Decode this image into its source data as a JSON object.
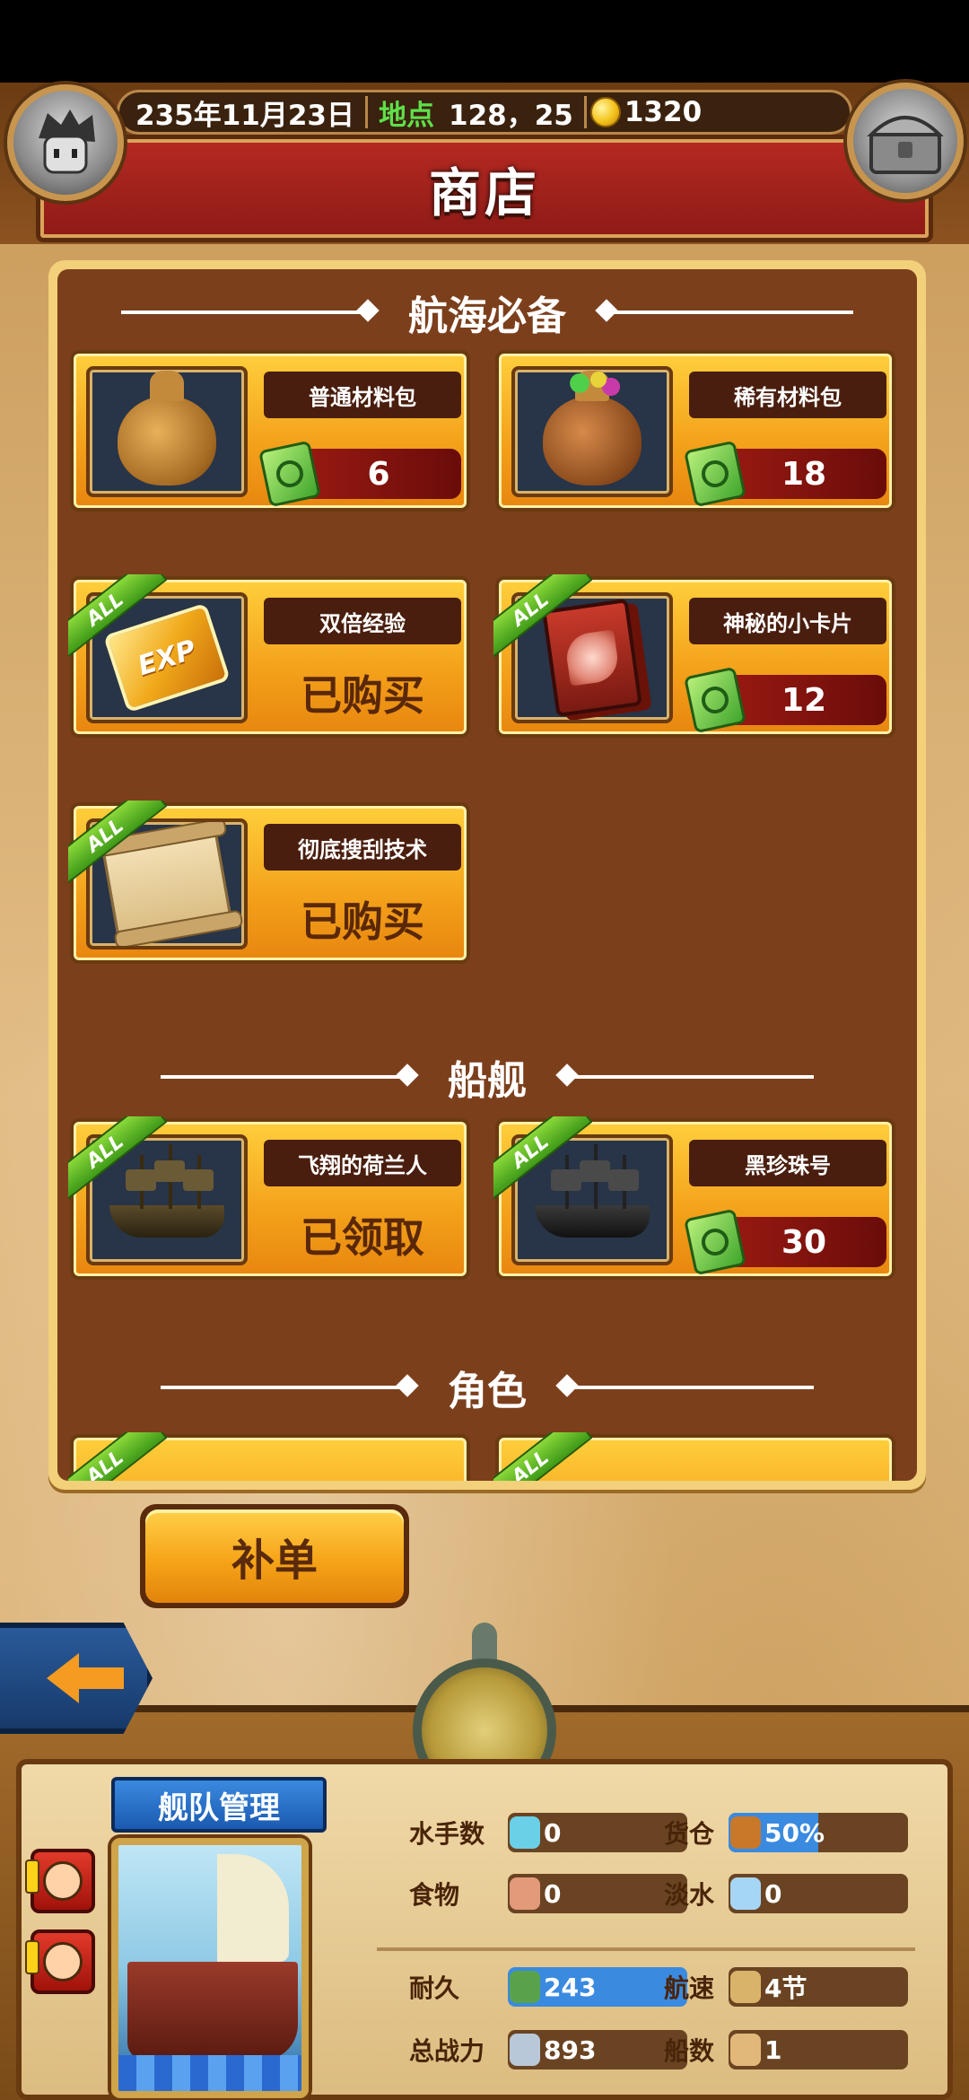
{
  "header": {
    "date": "235年11月23日",
    "location_label": "地点",
    "location_value": "128，25",
    "gold": "1320",
    "title": "商店"
  },
  "sections": [
    {
      "title": "航海必备"
    },
    {
      "title": "船舰"
    },
    {
      "title": "角色"
    }
  ],
  "items": [
    {
      "name": "普通材料包",
      "price": "6",
      "status": "",
      "icon": "material-bag-icon",
      "badge": ""
    },
    {
      "name": "稀有材料包",
      "price": "18",
      "status": "",
      "icon": "rare-material-bag-icon",
      "badge": ""
    },
    {
      "name": "双倍经验",
      "price": "",
      "status": "已购买",
      "icon": "exp-card-icon",
      "badge": "ALL"
    },
    {
      "name": "神秘的小卡片",
      "price": "12",
      "status": "",
      "icon": "dragon-card-icon",
      "badge": "ALL"
    },
    {
      "name": "彻底搜刮技术",
      "price": "",
      "status": "已购买",
      "icon": "treasure-map-icon",
      "badge": "ALL"
    },
    {
      "name": "飞翔的荷兰人",
      "price": "",
      "status": "已领取",
      "icon": "ghost-ship-icon",
      "badge": "ALL"
    },
    {
      "name": "黑珍珠号",
      "price": "30",
      "status": "",
      "icon": "black-pearl-ship-icon",
      "badge": "ALL"
    }
  ],
  "reorder_button": "补单",
  "fleet": {
    "title": "舰队管理",
    "stats": {
      "sailors_label": "水手数",
      "sailors_value": "0",
      "cargo_label": "货仓",
      "cargo_value": "50%",
      "cargo_fraction": 0.5,
      "food_label": "食物",
      "food_value": "0",
      "water_label": "淡水",
      "water_value": "0",
      "durability_label": "耐久",
      "durability_value": "243",
      "speed_label": "航速",
      "speed_value": "4节",
      "power_label": "总战力",
      "power_value": "893",
      "ships_label": "船数",
      "ships_value": "1"
    }
  },
  "colors": {
    "title_red": "#b52a22",
    "card_gold": "#f3a01a",
    "panel_brown": "#7c3f1c",
    "badge_green": "#3f9a18",
    "accent_blue": "#3a8ae0"
  }
}
